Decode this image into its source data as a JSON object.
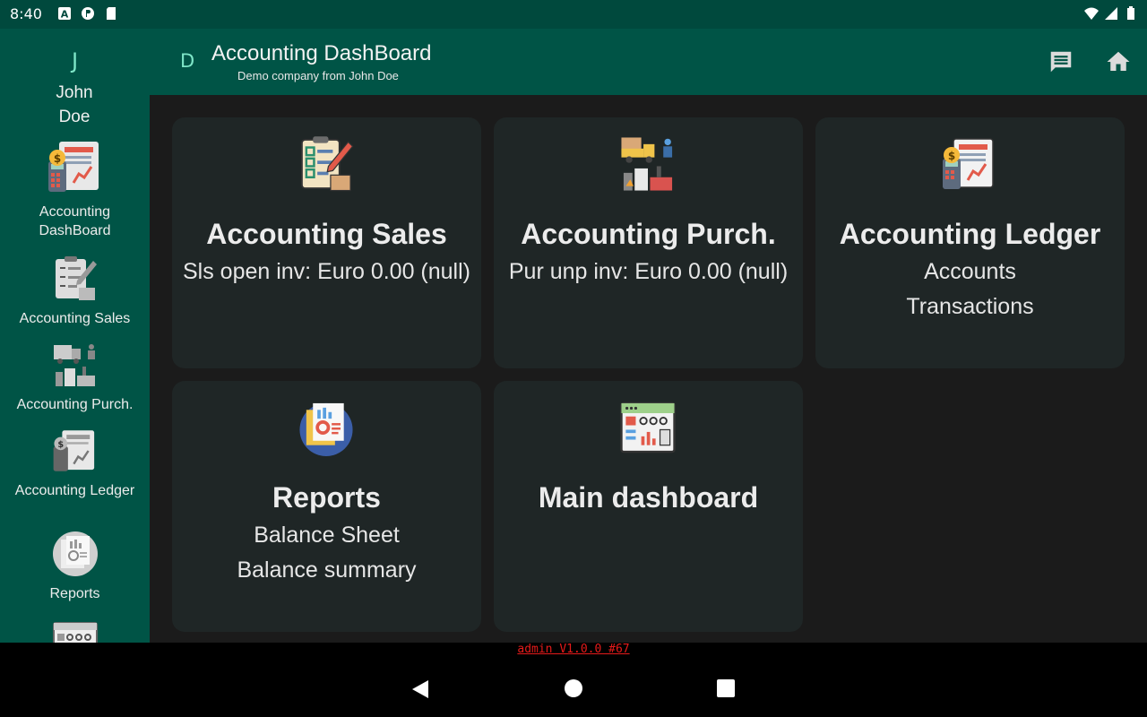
{
  "status": {
    "time": "8:40"
  },
  "sidebar": {
    "avatar_letter": "J",
    "user_name": "John Doe",
    "items": [
      {
        "label": "Accounting DashBoard",
        "icon": "accounting-calculator-icon"
      },
      {
        "label": "Accounting Sales",
        "icon": "clipboard-checklist-icon"
      },
      {
        "label": "Accounting Purch.",
        "icon": "delivery-truck-factory-icon"
      },
      {
        "label": "Accounting Ledger",
        "icon": "ledger-calculator-icon"
      },
      {
        "label": "Reports",
        "icon": "reports-icon"
      },
      {
        "label": "",
        "icon": "dashboard-window-icon"
      }
    ]
  },
  "appbar": {
    "letter": "D",
    "title": "Accounting DashBoard",
    "subtitle": "Demo company from John Doe"
  },
  "cards": [
    {
      "title": "Accounting Sales",
      "lines": [
        "Sls open inv: Euro 0.00 (null)"
      ],
      "icon": "clipboard-checklist-icon"
    },
    {
      "title": "Accounting Purch.",
      "lines": [
        "Pur unp inv: Euro 0.00 (null)"
      ],
      "icon": "delivery-truck-factory-icon"
    },
    {
      "title": "Accounting Ledger",
      "lines": [
        "Accounts",
        "Transactions"
      ],
      "icon": "ledger-calculator-icon"
    },
    {
      "title": "Reports",
      "lines": [
        "Balance Sheet",
        "Balance summary"
      ],
      "icon": "reports-icon"
    },
    {
      "title": "Main dashboard",
      "lines": [],
      "icon": "dashboard-window-icon"
    }
  ],
  "footer": {
    "version": "admin V1.0.0 #67"
  },
  "colors": {
    "primary": "#005446",
    "accent": "#7ee6c8",
    "card": "#1f2626",
    "version_text": "#e51a1a"
  }
}
